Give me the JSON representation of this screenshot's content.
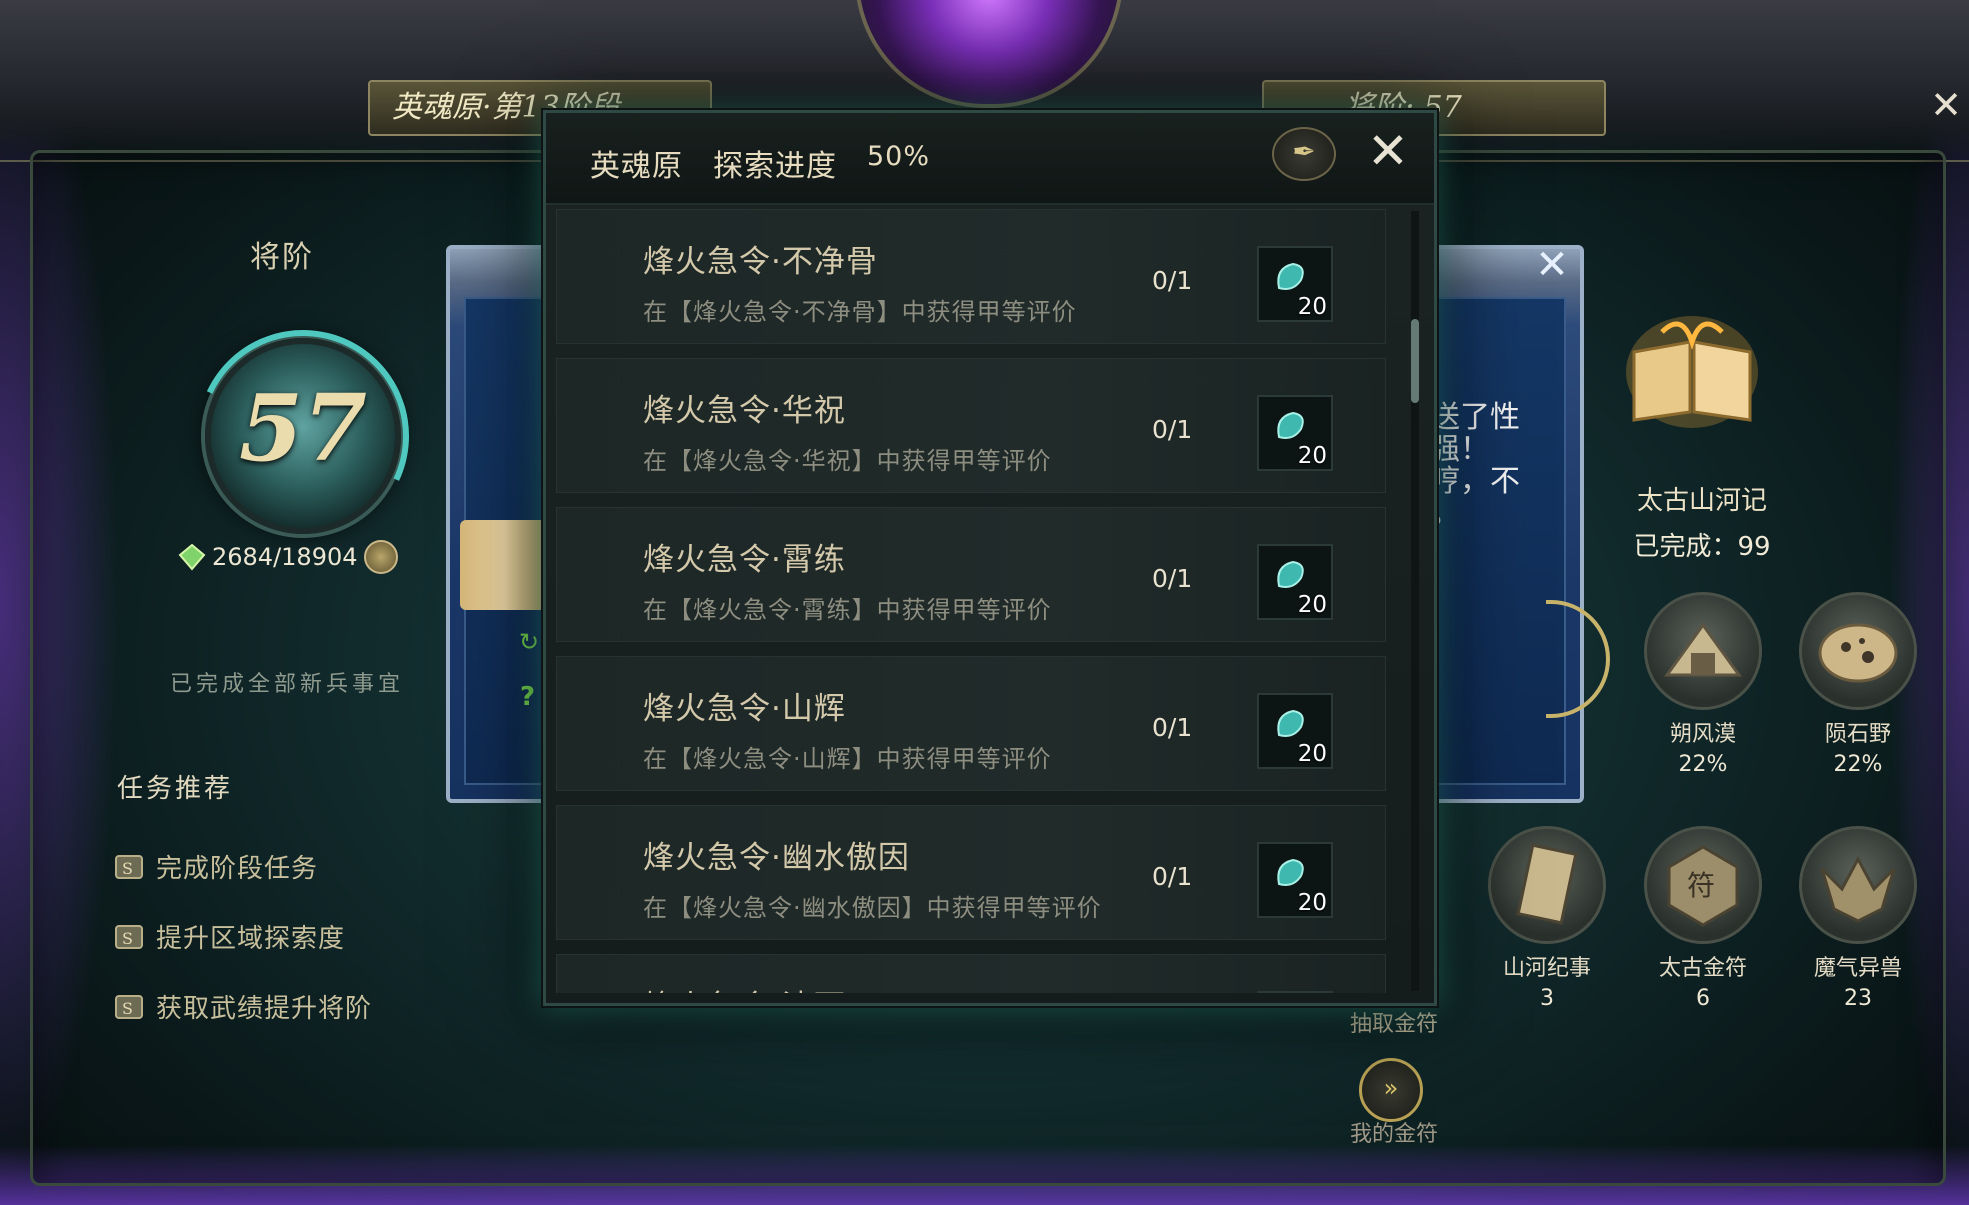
{
  "top": {
    "stage_plaque": "英魂原·第13阶段",
    "rank_plaque": "将阶: 57"
  },
  "left": {
    "title": "将阶",
    "rank_value": "57",
    "exp_text": "2684/18904",
    "status": "已完成全部新兵事宜",
    "recommend_title": "任务推荐",
    "recommend_items": [
      "完成阶段任务",
      "提升区域探索度",
      "获取武绩提升将阶"
    ]
  },
  "behind_dialog": {
    "text": [
      "送了性",
      "强！",
      "哼，不",
      "。"
    ]
  },
  "right": {
    "book_title": "太古山河记",
    "book_done": "已完成：99",
    "regions": [
      {
        "name": "朔风漠",
        "value": "22%"
      },
      {
        "name": "陨石野",
        "value": "22%"
      }
    ],
    "collections": [
      {
        "name": "山河纪事",
        "value": "3"
      },
      {
        "name": "太古金符",
        "value": "6"
      },
      {
        "name": "魔气异兽",
        "value": "23"
      }
    ],
    "draw_label": "抽取金符",
    "my_coin_label": "我的金符"
  },
  "dialog": {
    "area": "英魂原",
    "progress_label": "探索进度",
    "progress_value": "50%",
    "rows": [
      {
        "name": "烽火急令·不净骨",
        "desc": "在【烽火急令·不净骨】中获得甲等评价",
        "progress": "0/1",
        "reward_count": "20"
      },
      {
        "name": "烽火急令·华祝",
        "desc": "在【烽火急令·华祝】中获得甲等评价",
        "progress": "0/1",
        "reward_count": "20"
      },
      {
        "name": "烽火急令·霄练",
        "desc": "在【烽火急令·霄练】中获得甲等评价",
        "progress": "0/1",
        "reward_count": "20"
      },
      {
        "name": "烽火急令·山辉",
        "desc": "在【烽火急令·山辉】中获得甲等评价",
        "progress": "0/1",
        "reward_count": "20"
      },
      {
        "name": "烽火急令·幽水傲因",
        "desc": "在【烽火急令·幽水傲因】中获得甲等评价",
        "progress": "0/1",
        "reward_count": "20"
      },
      {
        "name": "烽火急令·清雨",
        "desc": "",
        "progress": "",
        "reward_count": ""
      }
    ]
  }
}
